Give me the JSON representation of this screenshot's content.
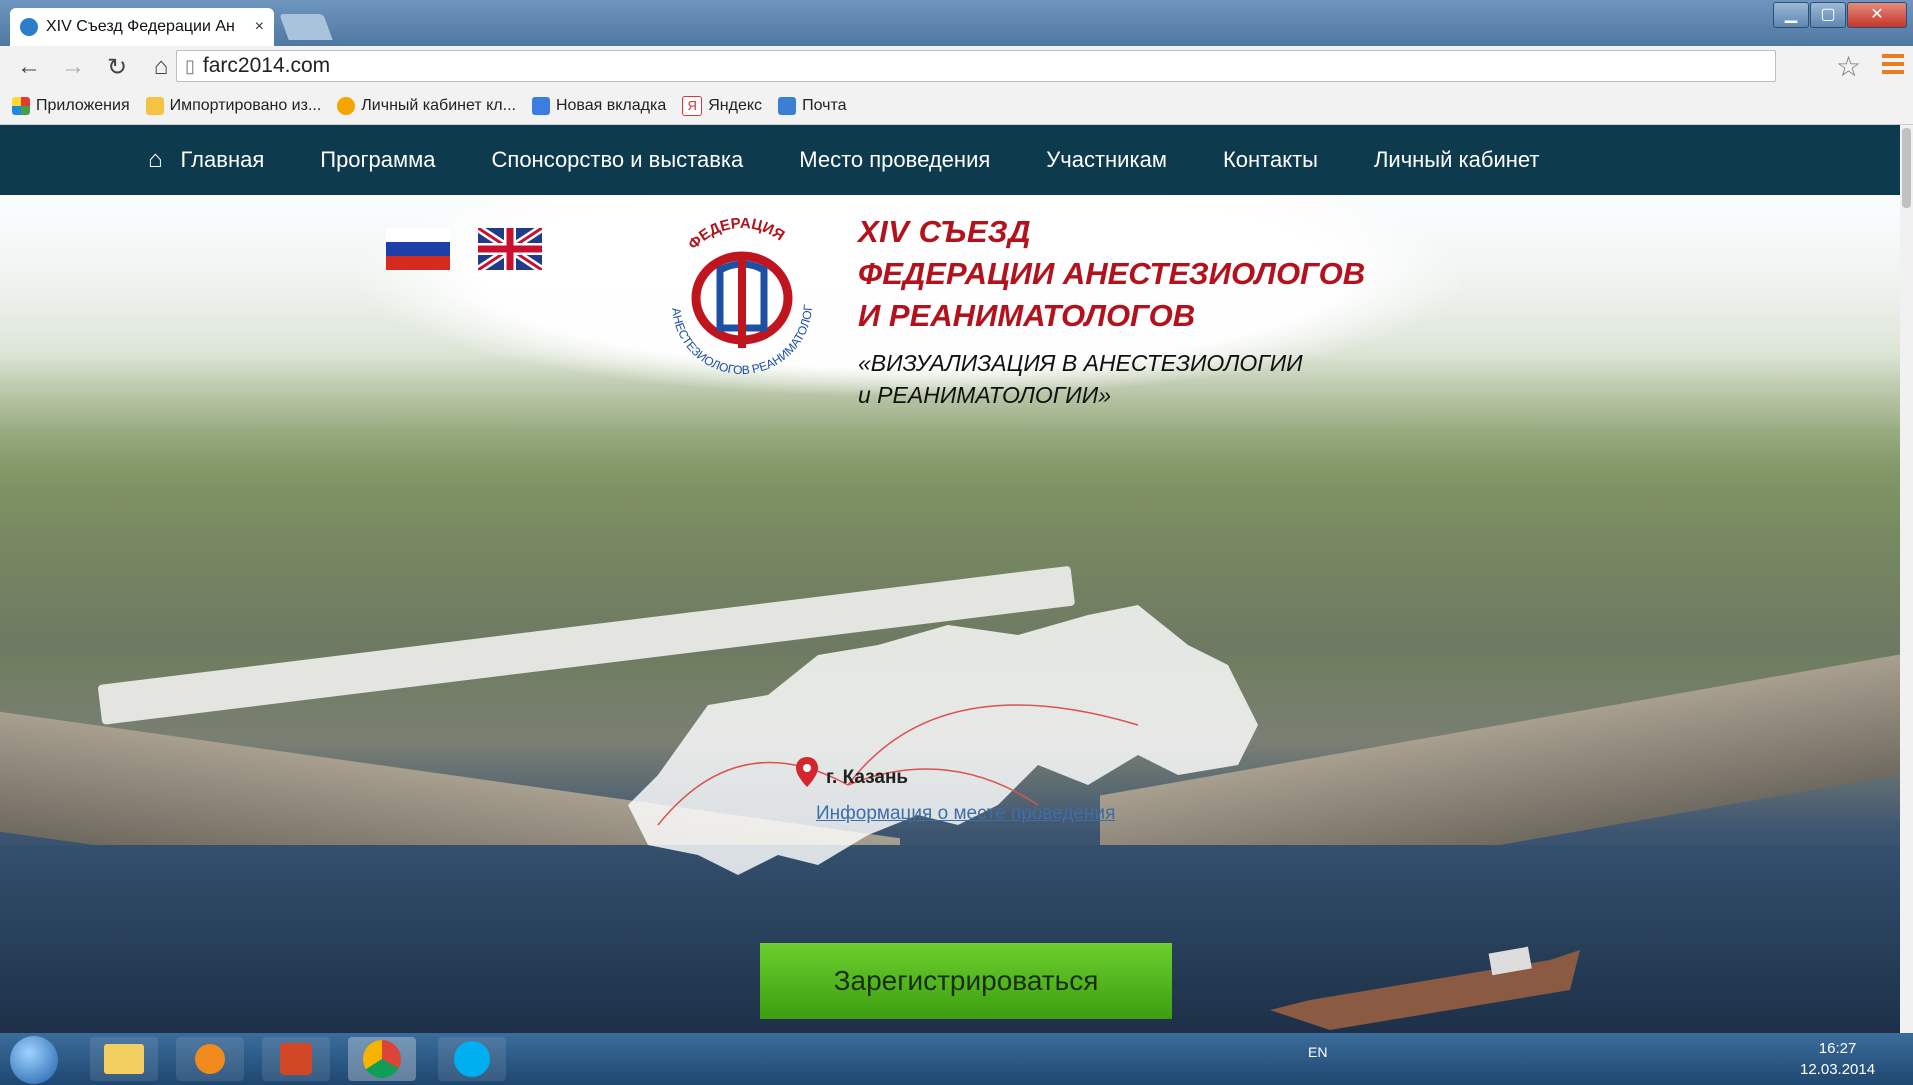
{
  "browser": {
    "tab_title": "XIV Съезд Федерации Ан",
    "tab_close": "×",
    "url": "farc2014.com",
    "controls": {
      "minimize": "▁",
      "maximize": "▢",
      "close": "✕"
    }
  },
  "bookmarks": [
    {
      "label": "Приложения",
      "icon": "apps-grid-icon"
    },
    {
      "label": "Импортировано из...",
      "icon": "folder-icon"
    },
    {
      "label": "Личный кабинет кл...",
      "icon": "bookmark-icon"
    },
    {
      "label": "Новая вкладка",
      "icon": "page-8-icon"
    },
    {
      "label": "Яндекс",
      "icon": "yandex-icon"
    },
    {
      "label": "Почта",
      "icon": "mail-icon"
    }
  ],
  "nav": {
    "items": [
      "Главная",
      "Программа",
      "Спонсорство и выставка",
      "Место проведения",
      "Участникам",
      "Контакты",
      "Личный кабинет"
    ]
  },
  "hero": {
    "logo_text_top": "ФЕДЕРАЦИЯ",
    "logo_text_left": "АНЕСТЕЗИОЛОГОВ",
    "logo_text_right": "РЕАНИМАТОЛОГОВ",
    "title_line1": "XIV СЪЕЗД",
    "title_line2": "ФЕДЕРАЦИИ АНЕСТЕЗИОЛОГОВ",
    "title_line3": "И РЕАНИМАТОЛОГОВ",
    "subtitle_line1": "«ВИЗУАЛИЗАЦИЯ В АНЕСТЕЗИОЛОГИИ",
    "subtitle_line2": "и РЕАНИМАТОЛОГИИ»",
    "city": "г. Казань",
    "venue_link": "Информация о месте проведения",
    "register_button": "Зарегистрироваться"
  },
  "taskbar": {
    "language": "EN",
    "time": "16:27",
    "date": "12.03.2014"
  },
  "colors": {
    "nav_bg": "#0d3a4c",
    "title_red": "#b3121d",
    "register_green": "#4cb51a"
  }
}
